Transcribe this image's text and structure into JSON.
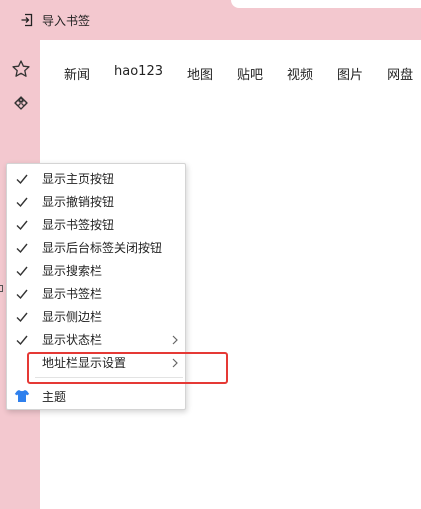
{
  "topbar": {
    "import_bookmarks": "导入书签",
    "import_icon": "import-arrow-icon"
  },
  "sidebar": {
    "items": [
      {
        "icon": "star-icon"
      },
      {
        "icon": "game-controller-icon"
      }
    ]
  },
  "nav": {
    "links": [
      "新闻",
      "hao123",
      "地图",
      "贴吧",
      "视频",
      "图片",
      "网盘"
    ]
  },
  "context_menu": {
    "items": [
      {
        "label": "显示主页按钮",
        "checked": true
      },
      {
        "label": "显示撤销按钮",
        "checked": true
      },
      {
        "label": "显示书签按钮",
        "checked": true
      },
      {
        "label": "显示后台标签关闭按钮",
        "checked": true
      },
      {
        "label": "显示搜索栏",
        "checked": true
      },
      {
        "label": "显示书签栏",
        "checked": true
      },
      {
        "label": "显示侧边栏",
        "checked": true
      },
      {
        "label": "显示状态栏",
        "checked": true,
        "submenu": true
      },
      {
        "label": "地址栏显示设置",
        "checked": false,
        "submenu": true
      }
    ],
    "theme": {
      "label": "主题",
      "icon": "tshirt-icon"
    }
  },
  "colors": {
    "chrome_pink": "#f3c8cf",
    "highlight_red": "#e53935",
    "theme_icon_blue": "#2f80ed"
  }
}
